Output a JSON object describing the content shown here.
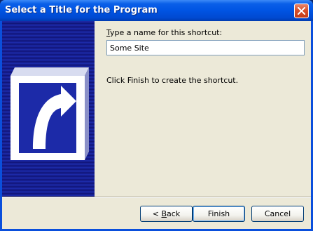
{
  "window": {
    "title": "Select a Title for the Program"
  },
  "form": {
    "name_label_accel": "T",
    "name_label_rest": "ype a name for this shortcut:",
    "name_value": "Some Site",
    "hint": "Click Finish to create the shortcut."
  },
  "buttons": {
    "back_prefix": "< ",
    "back_accel": "B",
    "back_rest": "ack",
    "finish": "Finish",
    "cancel": "Cancel"
  },
  "icons": {
    "close": "close-icon",
    "banner": "shortcut-arrow-icon"
  },
  "colors": {
    "titlebar": "#0054e3",
    "banner": "#1c2aa8",
    "dialog_bg": "#ece9d8",
    "close": "#d8502a"
  }
}
